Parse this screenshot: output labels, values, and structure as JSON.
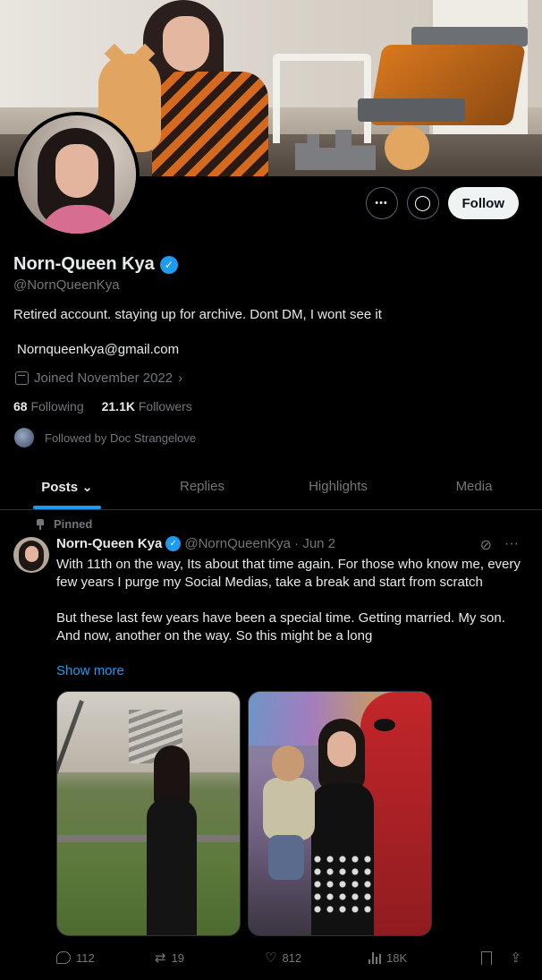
{
  "profile": {
    "display_name": "Norn-Queen Kya",
    "verified_mark": "✓",
    "handle": "@NornQueenKya",
    "bio": "Retired account. staying up for archive. Dont DM, I wont see it",
    "email": "Nornqueenkya@gmail.com",
    "joined": "Joined November 2022",
    "following_count": "68",
    "following_label": "Following",
    "followers_count": "21.1K",
    "followers_label": "Followers",
    "followed_by": "Followed by Doc Strangelove"
  },
  "actions": {
    "more_icon": "•••",
    "message_icon": "◯",
    "follow_label": "Follow"
  },
  "tabs": [
    {
      "label": "Posts ⌄",
      "active": true
    },
    {
      "label": "Replies",
      "active": false
    },
    {
      "label": "Highlights",
      "active": false
    },
    {
      "label": "Media",
      "active": false
    }
  ],
  "post": {
    "pinned_label": "Pinned",
    "author": "Norn-Queen Kya",
    "meta": "@NornQueenKya · Jun 2",
    "grok_icon": "⊘",
    "more_icon": "···",
    "text": "With 11th on the way, Its about that time again. For those who know me, every few years I purge my Social Medias, take a break and start from scratch\n\nBut these last few years have been a special time. Getting married. My son. And now, another on the way. So this might be a long",
    "show_more": "Show more",
    "replies": "112",
    "reposts": "19",
    "likes": "812",
    "views": "18K"
  },
  "colors": {
    "accent": "#1d9bf0",
    "background": "#000000",
    "muted": "#71767b",
    "text": "#e7e9ea"
  }
}
